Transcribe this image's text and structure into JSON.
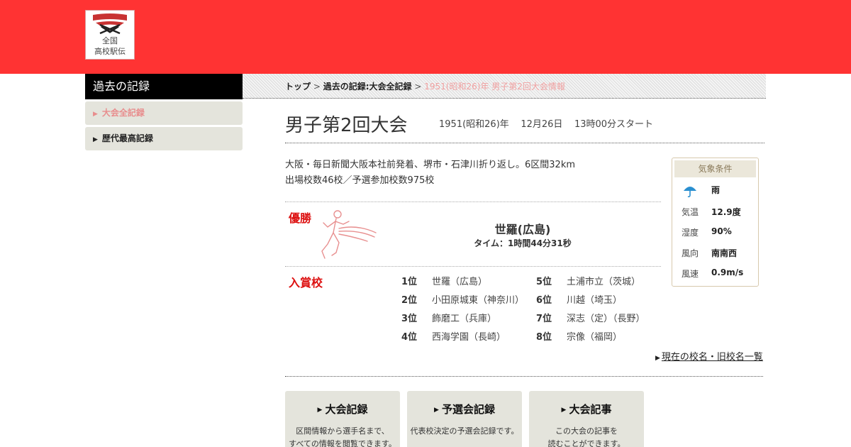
{
  "site": {
    "logo_line1": "全国",
    "logo_line2": "高校駅伝",
    "brand_color": "#ff3333"
  },
  "sidebar": {
    "title": "過去の記録",
    "items": [
      {
        "label": "大会全記録",
        "active": true
      },
      {
        "label": "歴代最高記録",
        "active": false
      }
    ]
  },
  "breadcrumb": {
    "items": [
      "トップ",
      "過去の記録:大会全記録"
    ],
    "separator": ">",
    "current": "1951(昭和26)年 男子第2回大会情報"
  },
  "race": {
    "title": "男子第2回大会",
    "year": "1951(昭和26)年",
    "date": "12月26日",
    "start": "13時00分スタート",
    "description_line1": "大阪・毎日新聞大阪本社前発着、堺市・石津川折り返し。6区間32km",
    "description_line2": "出場校数46校／予選参加校数975校"
  },
  "weather": {
    "title": "気象条件",
    "condition_icon": "umbrella-icon",
    "condition": "雨",
    "rows": [
      {
        "label": "気温",
        "value": "12.9度"
      },
      {
        "label": "湿度",
        "value": "90%"
      },
      {
        "label": "風向",
        "value": "南南西"
      },
      {
        "label": "風速",
        "value": "0.9m/s"
      }
    ]
  },
  "winner": {
    "label": "優勝",
    "school": "世羅(広島)",
    "time": "タイム：1時間44分31秒"
  },
  "prize": {
    "label": "入賞校",
    "ranks": [
      {
        "rank": "1位",
        "school": "世羅（広島）"
      },
      {
        "rank": "2位",
        "school": "小田原城東（神奈川）"
      },
      {
        "rank": "3位",
        "school": "飾磨工（兵庫）"
      },
      {
        "rank": "4位",
        "school": "西海学園（長崎）"
      },
      {
        "rank": "5位",
        "school": "土浦市立（茨城）"
      },
      {
        "rank": "6位",
        "school": "川越（埼玉）"
      },
      {
        "rank": "7位",
        "school": "深志（定）（長野）"
      },
      {
        "rank": "8位",
        "school": "宗像（福岡）"
      }
    ]
  },
  "links": {
    "old_names": "現在の校名・旧校名一覧"
  },
  "cards": [
    {
      "title": "大会記録",
      "line1": "区間情報から選手名まで、",
      "line2": "すべての情報を閲覧できます。"
    },
    {
      "title": "予選会記録",
      "line1": "代表校決定の予選会記録です。",
      "line2": ""
    },
    {
      "title": "大会記事",
      "line1": "この大会の記事を",
      "line2": "読むことができます。"
    }
  ]
}
